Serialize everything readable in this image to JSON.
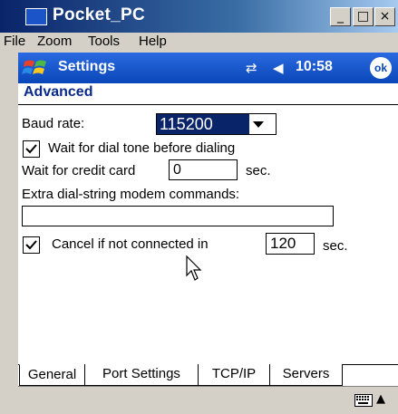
{
  "window": {
    "title": "Pocket_PC",
    "minimize_glyph": "_",
    "maximize_glyph": "□",
    "close_glyph": "×"
  },
  "menu": {
    "items": [
      "File",
      "Zoom",
      "Tools",
      "Help"
    ]
  },
  "navbar": {
    "title": "Settings",
    "connectivity_glyph": "⇄",
    "volume_glyph": "◀",
    "time": "10:58",
    "ok_label": "ok"
  },
  "page": {
    "header": "Advanced"
  },
  "form": {
    "baud_label": "Baud rate:",
    "baud_value": "115200",
    "wait_dial_label": "Wait for dial tone before dialing",
    "wait_dial_checked": true,
    "credit_label": "Wait for credit card",
    "credit_value": "0",
    "credit_unit": "sec.",
    "extra_label": "Extra dial-string modem commands:",
    "extra_value": "",
    "cancel_label": "Cancel if not connected in",
    "cancel_checked": true,
    "cancel_value": "120",
    "cancel_unit": "sec."
  },
  "tabs": {
    "items": [
      "General",
      "Port Settings",
      "TCP/IP",
      "Servers"
    ],
    "active": "General"
  },
  "icons": {
    "start": "windows-start-icon",
    "keyboard": "keyboard-icon",
    "sip_arrow": "up-arrow-icon",
    "cursor": "mouse-pointer-icon"
  }
}
